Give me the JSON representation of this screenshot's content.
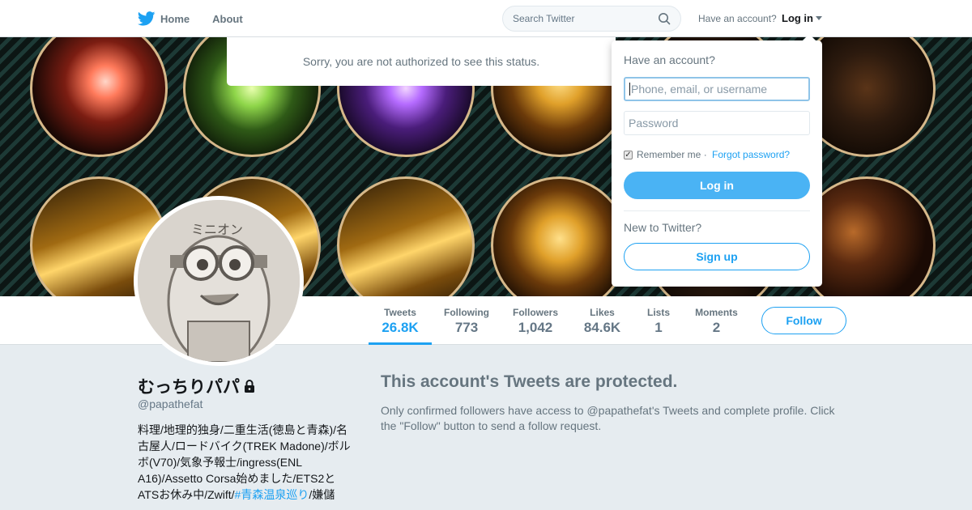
{
  "nav": {
    "home_label": "Home",
    "about_label": "About",
    "search_placeholder": "Search Twitter",
    "have_account_text": "Have an account?",
    "login_label": "Log in"
  },
  "error_bar": {
    "message": "Sorry, you are not authorized to see this status."
  },
  "stats": [
    {
      "label": "Tweets",
      "value": "26.8K"
    },
    {
      "label": "Following",
      "value": "773"
    },
    {
      "label": "Followers",
      "value": "1,042"
    },
    {
      "label": "Likes",
      "value": "84.6K"
    },
    {
      "label": "Lists",
      "value": "1"
    },
    {
      "label": "Moments",
      "value": "2"
    }
  ],
  "follow_label": "Follow",
  "profile": {
    "name": "むっちりパパ",
    "handle": "@papathefat",
    "bio_text": "料理/地理的独身/二重生活(徳島と青森)/名古屋人/ロードバイク(TREK Madone)/ボルボ(V70)/気象予報士/ingress(ENL A16)/Assetto Corsa始めました/ETS2とATSお休み中/Zwift/",
    "bio_hashtag": "#青森温泉巡り",
    "bio_tail": "/嫌儲"
  },
  "protected": {
    "title": "This account's Tweets are protected.",
    "body": "Only confirmed followers have access to @papathefat's Tweets and complete profile. Click the \"Follow\" button to send a follow request."
  },
  "login_dropdown": {
    "heading": "Have an account?",
    "username_placeholder": "Phone, email, or username",
    "password_placeholder": "Password",
    "remember_label": "Remember me",
    "separator": " · ",
    "forgot_label": "Forgot password?",
    "login_button": "Log in",
    "new_to_twitter": "New to Twitter?",
    "signup_button": "Sign up"
  },
  "colors": {
    "accent": "#1da1f2",
    "login_button_bg": "#4ab3f4",
    "page_bg": "#e6ecf0"
  }
}
